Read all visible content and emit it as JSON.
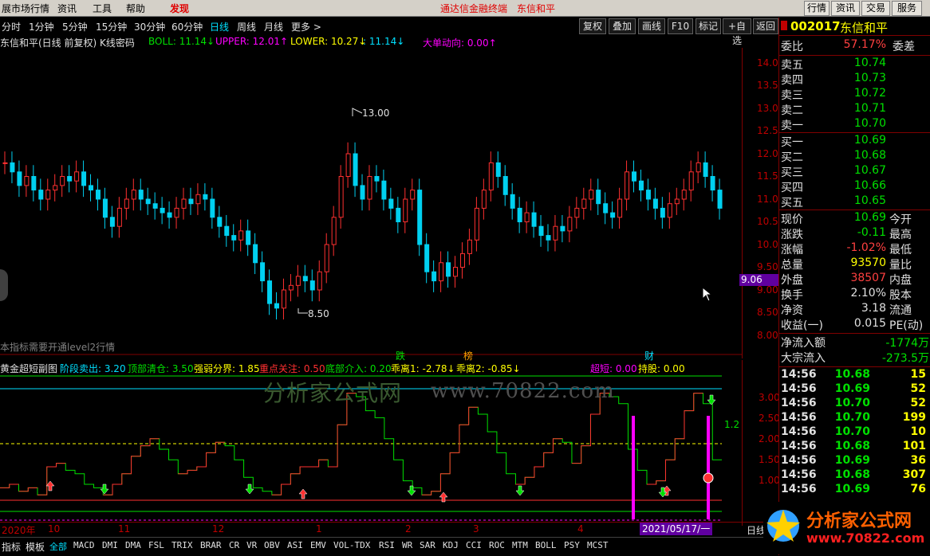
{
  "topmenu": {
    "items": [
      "展市场行情",
      "资讯",
      "工具",
      "帮助"
    ],
    "discover": "发现",
    "banner": "通达信金融终端",
    "stock_title": "东信和平",
    "right_buttons": [
      "行情",
      "资讯",
      "交易",
      "服务"
    ]
  },
  "periodbar": {
    "items": [
      "分时",
      "1分钟",
      "5分钟",
      "15分钟",
      "30分钟",
      "60分钟",
      "日线",
      "周线",
      "月线",
      "更多 >"
    ],
    "active": "日线",
    "tools": [
      "复权",
      "叠加",
      "画线",
      "F10",
      "标记",
      "+自选",
      "返回"
    ]
  },
  "infoline": {
    "title": "东信和平(日线 前复权) K线密码",
    "boll": "BOLL: 11.14↓",
    "upper": "UPPER: 12.01↑",
    "lower": "LOWER: 10.27↓",
    "mid": ": 11.14↓",
    "bigorder": "大单动向: 0.00↑"
  },
  "mainchart": {
    "high_label": "13.00",
    "low_label": "8.50",
    "level2_note": "本指标需要开通level2行情",
    "yaxis": [
      "14.00",
      "13.50",
      "13.00",
      "12.50",
      "12.00",
      "11.50",
      "11.00",
      "10.50",
      "10.00",
      "9.50",
      "9.00",
      "8.50",
      "8.00"
    ],
    "cursor_price": "9.06"
  },
  "subchart": {
    "title": "黄金超短副图",
    "items": [
      "阶段卖出: 3.20",
      "顶部清仓: 3.50",
      "强弱分界: 1.85",
      "重点关注: 0.50",
      "底部介入: 0.20",
      "乖离1: -2.78↓",
      "乖离2: -0.85↓",
      "超短: 0.00",
      "持股: 0.00"
    ],
    "markers": [
      "跌",
      "榜",
      "财"
    ],
    "side_value": "1.2",
    "yaxis": [
      "3.00",
      "2.50",
      "2.00",
      "1.50",
      "1.00"
    ]
  },
  "xaxis": {
    "labels": [
      "2020年",
      "10",
      "11",
      "12",
      "1",
      "2",
      "3",
      "4"
    ],
    "cursor_date": "2021/05/17/一",
    "right_label": "日线"
  },
  "rightpanel": {
    "code": "002017",
    "name": "东信和平",
    "weibi_label": "委比",
    "weibi_val": "57.17%",
    "weicha_label": "委差",
    "sell": [
      {
        "label": "卖五",
        "price": "10.74"
      },
      {
        "label": "卖四",
        "price": "10.73"
      },
      {
        "label": "卖三",
        "price": "10.72"
      },
      {
        "label": "卖二",
        "price": "10.71"
      },
      {
        "label": "卖一",
        "price": "10.70"
      }
    ],
    "buy": [
      {
        "label": "买一",
        "price": "10.69"
      },
      {
        "label": "买二",
        "price": "10.68"
      },
      {
        "label": "买三",
        "price": "10.67"
      },
      {
        "label": "买四",
        "price": "10.66"
      },
      {
        "label": "买五",
        "price": "10.65"
      }
    ],
    "stats": [
      {
        "label": "现价",
        "val": "10.69",
        "label2": "今开"
      },
      {
        "label": "涨跌",
        "val": "-0.11",
        "label2": "最高"
      },
      {
        "label": "涨幅",
        "val": "-1.02%",
        "label2": "最低"
      },
      {
        "label": "总量",
        "val": "93570",
        "label2": "量比"
      },
      {
        "label": "外盘",
        "val": "38507",
        "label2": "内盘"
      },
      {
        "label": "换手",
        "val": "2.10%",
        "label2": "股本"
      },
      {
        "label": "净资",
        "val": "3.18",
        "label2": "流通"
      },
      {
        "label": "收益(一)",
        "val": "0.015",
        "label2": "PE(动)"
      }
    ],
    "flow": [
      {
        "label": "净流入额",
        "val": "-1774万"
      },
      {
        "label": "大宗流入",
        "val": "-273.5万"
      }
    ],
    "ticks": [
      {
        "t": "14:56",
        "p": "10.68",
        "v": "15"
      },
      {
        "t": "14:56",
        "p": "10.69",
        "v": "52"
      },
      {
        "t": "14:56",
        "p": "10.70",
        "v": "52"
      },
      {
        "t": "14:56",
        "p": "10.70",
        "v": "199"
      },
      {
        "t": "14:56",
        "p": "10.70",
        "v": "10"
      },
      {
        "t": "14:56",
        "p": "10.68",
        "v": "101"
      },
      {
        "t": "14:56",
        "p": "10.69",
        "v": "36"
      },
      {
        "t": "14:56",
        "p": "10.68",
        "v": "307"
      },
      {
        "t": "14:56",
        "p": "10.69",
        "v": "76"
      }
    ]
  },
  "bottomtabs": {
    "items": [
      "指标",
      "模板",
      "全部",
      "MACD",
      "DMI",
      "DMA",
      "FSL",
      "TRIX",
      "BRAR",
      "CR",
      "VR",
      "OBV",
      "ASI",
      "EMV",
      "VOL-TDX",
      "RSI",
      "WR",
      "SAR",
      "KDJ",
      "CCI",
      "ROC",
      "MTM",
      "BOLL",
      "PSY",
      "MCST"
    ],
    "active": "全部"
  },
  "watermark": {
    "text1": "分析家公式网",
    "text2": "www.70822.com",
    "logo_text": "分析家公式网",
    "logo_url": "www.70822.com"
  },
  "colors": {
    "up": "#ff3030",
    "down": "#00d0f0",
    "boll_up": "#ff00ff",
    "bg": "#000000"
  }
}
